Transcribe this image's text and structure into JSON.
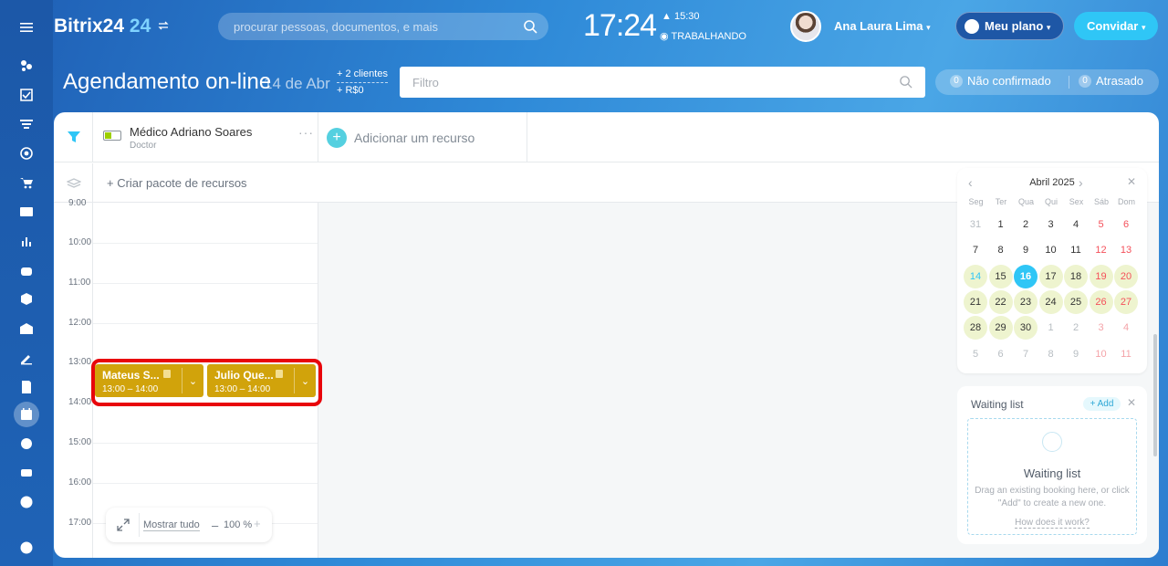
{
  "app": {
    "name": "Bitrix24",
    "version": "24"
  },
  "search": {
    "placeholder": "procurar pessoas, documentos, e mais"
  },
  "clock": {
    "time": "17:24",
    "alarm": "15:30",
    "status": "TRABALHANDO"
  },
  "user": {
    "name": "Ana Laura Lima"
  },
  "plan_button": "Meu plano",
  "invite_button": "Convidar",
  "page": {
    "title": "Agendamento on-line",
    "date": "14 de Abr",
    "clients": "+ 2 clientes",
    "revenue": "+ R$0"
  },
  "filter": {
    "placeholder": "Filtro"
  },
  "counters": [
    {
      "count": "0",
      "label": "Não confirmado"
    },
    {
      "count": "0",
      "label": "Atrasado"
    }
  ],
  "resource": {
    "name": "Médico Adriano Soares",
    "role": "Doctor",
    "more": "···"
  },
  "add_resource": "Adicionar um recurso",
  "create_package": "+ Criar pacote de recursos",
  "hours": [
    "9:00",
    "10:00",
    "11:00",
    "12:00",
    "13:00",
    "14:00",
    "15:00",
    "16:00",
    "17:00"
  ],
  "bookings": [
    {
      "name": "Mateus S...",
      "time": "13:00 – 14:00"
    },
    {
      "name": "Julio Que...",
      "time": "13:00 – 14:00"
    }
  ],
  "zoom": {
    "show_all": "Mostrar tudo",
    "minus": "–",
    "value": "100 %",
    "plus": "+"
  },
  "calendar": {
    "month": "Abril 2025",
    "weekdays": [
      "Seg",
      "Ter",
      "Qua",
      "Qui",
      "Sex",
      "Sáb",
      "Dom"
    ],
    "weeks": [
      [
        "31",
        "1",
        "2",
        "3",
        "4",
        "5",
        "6"
      ],
      [
        "7",
        "8",
        "9",
        "10",
        "11",
        "12",
        "13"
      ],
      [
        "14",
        "15",
        "16",
        "17",
        "18",
        "19",
        "20"
      ],
      [
        "21",
        "22",
        "23",
        "24",
        "25",
        "26",
        "27"
      ],
      [
        "28",
        "29",
        "30",
        "1",
        "2",
        "3",
        "4"
      ],
      [
        "5",
        "6",
        "7",
        "8",
        "9",
        "10",
        "11"
      ]
    ],
    "today": "16"
  },
  "waiting_list": {
    "title": "Waiting list",
    "add": "+ Add",
    "heading": "Waiting list",
    "description": "Drag an existing booking here, or click \"Add\" to create a new one.",
    "link": "How does it work?"
  },
  "colors": {
    "accent": "#2fc6f6",
    "booking": "#d1a30b",
    "highlight": "#e8050b"
  }
}
